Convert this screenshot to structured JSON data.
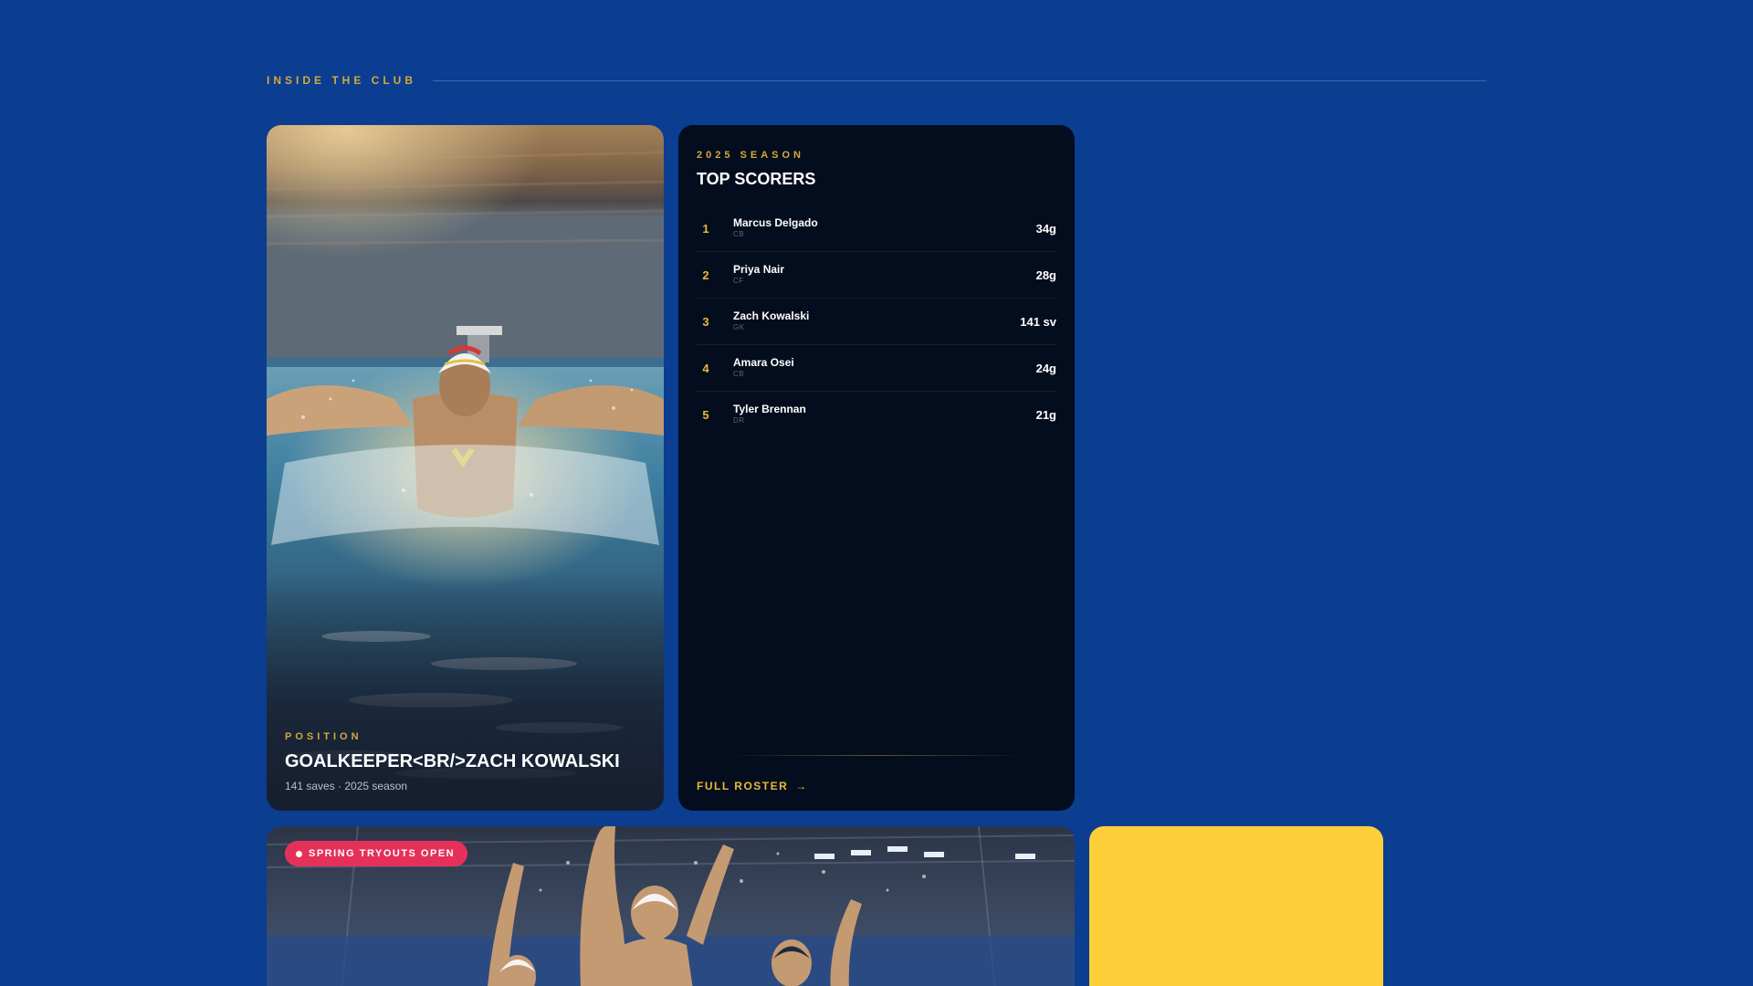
{
  "section": {
    "eyebrow": "INSIDE THE CLUB"
  },
  "player_card": {
    "image_subject": "water polo goalkeeper rising from pool with arms outstretched",
    "eyebrow": "POSITION",
    "title": "GOALKEEPER<BR/>ZACH KOWALSKI",
    "meta": "141 saves · 2025 season"
  },
  "scorers": {
    "eyebrow": "2025 SEASON",
    "title": "TOP SCORERS",
    "rows": [
      {
        "rank": "1",
        "name": "Marcus Delgado",
        "position": "CB",
        "stat": "34g"
      },
      {
        "rank": "2",
        "name": "Priya Nair",
        "position": "CF",
        "stat": "28g"
      },
      {
        "rank": "3",
        "name": "Zach Kowalski",
        "position": "GK",
        "stat": "141 sv"
      },
      {
        "rank": "4",
        "name": "Amara Osei",
        "position": "CB",
        "stat": "24g"
      },
      {
        "rank": "5",
        "name": "Tyler Brennan",
        "position": "DR",
        "stat": "21g"
      }
    ],
    "link_label": "FULL ROSTER",
    "link_icon": "arrow-right-icon"
  },
  "team_card": {
    "image_subject": "water polo players contesting the ball in an indoor pool",
    "badge_label": "SPRING TRYOUTS OPEN"
  },
  "colors": {
    "background": "#0b3d91",
    "accent_gold": "#d5a93a",
    "badge_red": "#e5315a",
    "card_dark": "#040d1d",
    "card_yellow": "#ffcf3a"
  }
}
